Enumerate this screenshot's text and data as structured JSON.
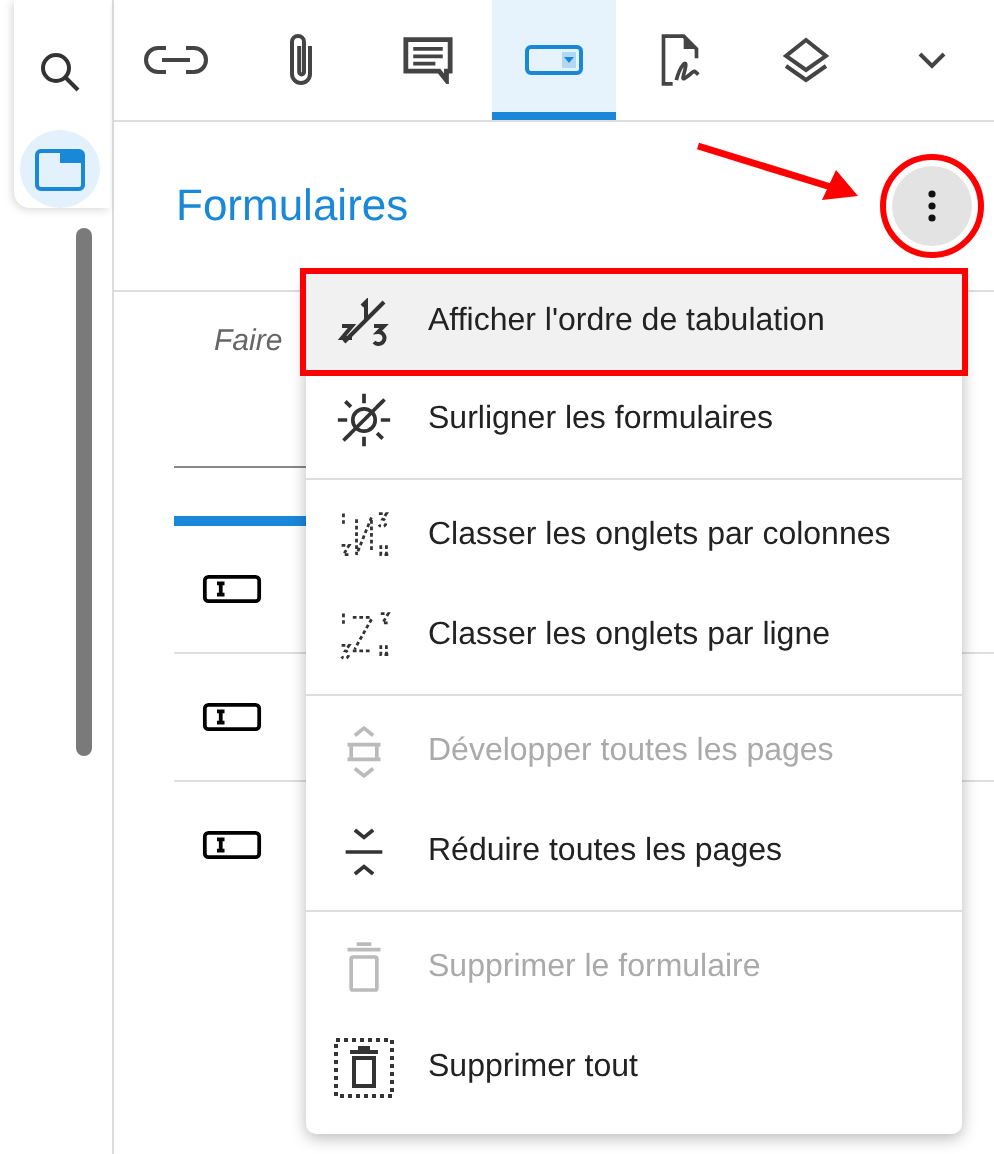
{
  "rail": {
    "items": [
      {
        "kind": "search",
        "selected": false
      },
      {
        "kind": "panel",
        "selected": true
      }
    ]
  },
  "toolbar": {
    "tabs": [
      {
        "kind": "link",
        "selected": false
      },
      {
        "kind": "attachment",
        "selected": false
      },
      {
        "kind": "comment",
        "selected": false
      },
      {
        "kind": "form",
        "selected": true
      },
      {
        "kind": "signature",
        "selected": false
      },
      {
        "kind": "layers",
        "selected": false
      },
      {
        "kind": "more",
        "selected": false
      }
    ]
  },
  "panel": {
    "title": "Formulaires",
    "menu_button": {
      "highlight_box": true
    },
    "hint": "Faire",
    "fields": [
      {
        "kind": "text-field"
      },
      {
        "kind": "text-field"
      },
      {
        "kind": "text-field"
      }
    ]
  },
  "annotation_arrow": true,
  "menu": {
    "groups": [
      [
        {
          "kind": "tab-order",
          "label": "Afficher l'ordre de tabulation",
          "disabled": false,
          "selected": true,
          "highlight_box": true
        },
        {
          "kind": "highlight-off",
          "label": "Surligner les formulaires",
          "disabled": false,
          "selected": false,
          "highlight_box": false
        }
      ],
      [
        {
          "kind": "columns",
          "label": "Classer les onglets par colonnes",
          "disabled": false,
          "selected": false,
          "highlight_box": false
        },
        {
          "kind": "rows",
          "label": "Classer les onglets par ligne",
          "disabled": false,
          "selected": false,
          "highlight_box": false
        }
      ],
      [
        {
          "kind": "expand",
          "label": "Développer toutes les pages",
          "disabled": true,
          "selected": false,
          "highlight_box": false
        },
        {
          "kind": "collapse",
          "label": "Réduire toutes les pages",
          "disabled": false,
          "selected": false,
          "highlight_box": false
        }
      ],
      [
        {
          "kind": "delete",
          "label": "Supprimer le formulaire",
          "disabled": true,
          "selected": false,
          "highlight_box": false
        },
        {
          "kind": "delete-all",
          "label": "Supprimer tout",
          "disabled": false,
          "selected": false,
          "highlight_box": false
        }
      ]
    ]
  }
}
